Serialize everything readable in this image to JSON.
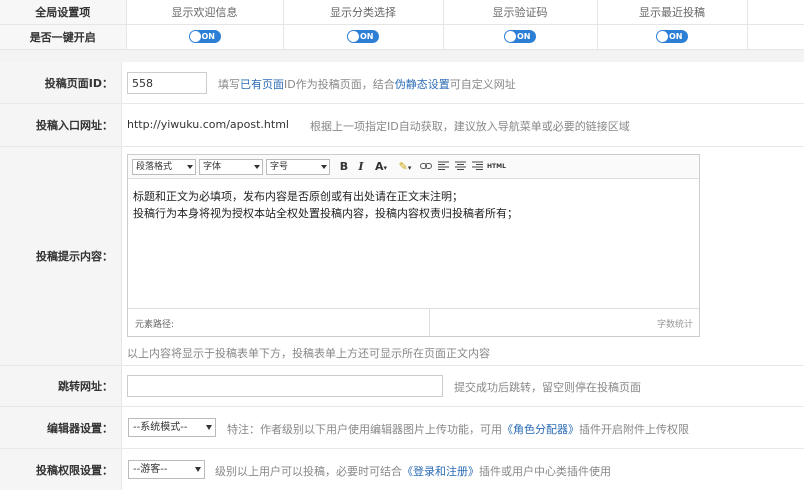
{
  "global": {
    "row_label": "全局设置项",
    "columns": [
      "显示欢迎信息",
      "显示分类选择",
      "显示验证码",
      "显示最近投稿"
    ],
    "onekey_label": "是否一键开启",
    "toggle_text": "ON"
  },
  "page_id": {
    "label": "投稿页面ID：",
    "value": "558",
    "hint_pre": "填写",
    "hint_link1": "已有页面",
    "hint_mid": "ID作为投稿页面，结合",
    "hint_link2": "伪静态设置",
    "hint_post": "可自定义网址"
  },
  "entry_url": {
    "label": "投稿入口网址：",
    "url": "http://yiwuku.com/apost.html",
    "hint": "根据上一项指定ID自动获取，建议放入导航菜单或必要的链接区域"
  },
  "prompt": {
    "label": "投稿提示内容：",
    "toolbar": {
      "format": "段落格式",
      "font": "字体",
      "size": "字号",
      "bold": "B",
      "italic": "I",
      "fontcolor": "A",
      "html": "HTML"
    },
    "lines": [
      "标题和正文为必填项，发布内容是否原创或有出处请在正文末注明；",
      "投稿行为本身将视为授权本站全权处置投稿内容，投稿内容权责归投稿者所有；"
    ],
    "path_label": "元素路径:",
    "word_count": "字数统计",
    "note": "以上内容将显示于投稿表单下方，投稿表单上方还可显示所在页面正文内容"
  },
  "redirect": {
    "label": "跳转网址：",
    "value": "",
    "hint": "提交成功后跳转，留空则停在投稿页面"
  },
  "editor_setting": {
    "label": "编辑器设置：",
    "selected": "--系统模式--",
    "hint_pre": "特注：作者级别以下用户使用编辑器图片上传功能，可用",
    "hint_link": "《角色分配器》",
    "hint_post": "插件开启附件上传权限"
  },
  "permission": {
    "label": "投稿权限设置：",
    "selected": "--游客--",
    "hint_pre": "级别以上用户可以投稿，必要时可结合",
    "hint_link": "《登录和注册》",
    "hint_post": "插件或用户中心类插件使用"
  },
  "colors": {
    "accent": "#2d7fd6",
    "link": "#2b6bb5"
  }
}
